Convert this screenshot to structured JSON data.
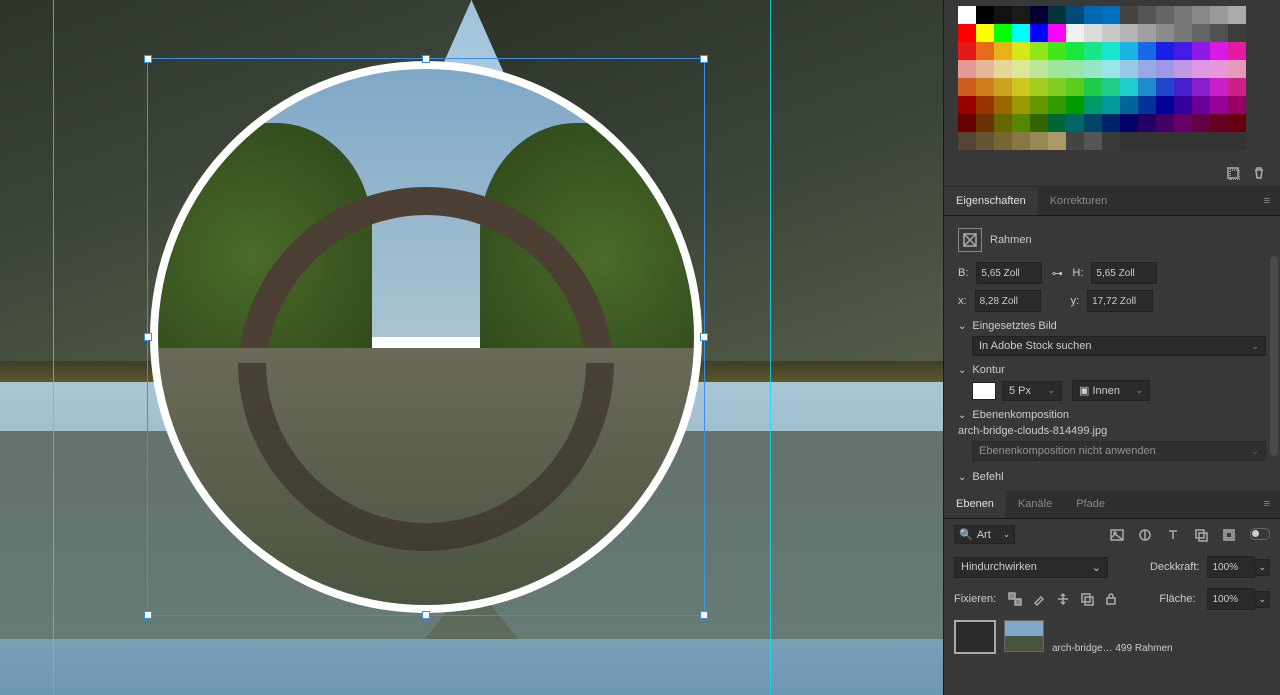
{
  "swatches": [
    [
      "#ffffff",
      "#000000",
      "#111111",
      "#1a1a1a",
      "#000033",
      "#00333a",
      "#004a7a",
      "#0068b0",
      "#006fc0",
      "#444444",
      "#555555",
      "#666666",
      "#777777",
      "#888888",
      "#999999",
      "#aaaaaa"
    ],
    [
      "#ff0000",
      "#ffff00",
      "#00ff00",
      "#00ffff",
      "#0000ff",
      "#ff00ff",
      "#f0f0f0",
      "#dcdcdc",
      "#c8c8c8",
      "#b4b4b4",
      "#a0a0a0",
      "#8c8c8c",
      "#787878",
      "#646464",
      "#505050",
      "#3c3c3c"
    ],
    [
      "#e61919",
      "#e66b19",
      "#e6b319",
      "#d6e619",
      "#8ce619",
      "#42e619",
      "#19e63e",
      "#19e688",
      "#19e6d1",
      "#19b3e6",
      "#1969e6",
      "#191fe6",
      "#4519e6",
      "#8f19e6",
      "#d919e6",
      "#e619a3"
    ],
    [
      "#e69999",
      "#e6b899",
      "#e6d699",
      "#dde699",
      "#bde699",
      "#9ee699",
      "#99e6a8",
      "#99e6c7",
      "#99e6e6",
      "#99c7e6",
      "#99a8e6",
      "#9e99e6",
      "#bd99e6",
      "#dd99e6",
      "#e699d6",
      "#e699b8"
    ],
    [
      "#cc5c1f",
      "#cc801f",
      "#cca31f",
      "#ccc71f",
      "#a3cc1f",
      "#80cc1f",
      "#5ccc1f",
      "#1fcc47",
      "#1fcc8a",
      "#1fcccc",
      "#1f8acc",
      "#1f47cc",
      "#471fcc",
      "#8a1fcc",
      "#cc1fcc",
      "#cc1f8a"
    ],
    [
      "#990000",
      "#993300",
      "#996600",
      "#999900",
      "#669900",
      "#339900",
      "#009900",
      "#009966",
      "#009999",
      "#006699",
      "#003399",
      "#000099",
      "#330099",
      "#660099",
      "#990099",
      "#990066"
    ],
    [
      "#660000",
      "#663300",
      "#666600",
      "#558800",
      "#336600",
      "#006633",
      "#006666",
      "#004466",
      "#002266",
      "#000066",
      "#220066",
      "#440066",
      "#660066",
      "#660044",
      "#660022",
      "#660011"
    ],
    [
      "#554433",
      "#665533",
      "#776633",
      "#887744",
      "#998855",
      "#aa9966",
      "#444444",
      "#555555",
      "#3a3a3a",
      "#333333",
      "#333333",
      "#333333",
      "#333333",
      "#333333",
      "#333333",
      "#333333"
    ]
  ],
  "propertiesPanel": {
    "tabs": {
      "properties": "Eigenschaften",
      "corrections": "Korrekturen"
    },
    "frame": "Rahmen",
    "w_label": "B:",
    "w_value": "5,65 Zoll",
    "h_label": "H:",
    "h_value": "5,65 Zoll",
    "x_label": "x:",
    "x_value": "8,28 Zoll",
    "y_label": "y:",
    "y_value": "17,72 Zoll",
    "linkedImage": "Eingesetztes Bild",
    "searchStock": "In Adobe Stock suchen",
    "stroke": "Kontur",
    "strokeSize": "5 Px",
    "strokeAlign": "Innen",
    "layerComp": "Ebenenkomposition",
    "fileName": "arch-bridge-clouds-814499.jpg",
    "compDropdown": "Ebenenkomposition nicht anwenden",
    "command": "Befehl"
  },
  "layersPanel": {
    "tabs": {
      "layers": "Ebenen",
      "channels": "Kanäle",
      "paths": "Pfade"
    },
    "kind": "Art",
    "blend": "Hindurchwirken",
    "opacityLabel": "Deckkraft:",
    "opacity": "100%",
    "lockLabel": "Fixieren:",
    "fillLabel": "Fläche:",
    "fill": "100%",
    "thumbLabel": "arch-bridge… 499 Rahmen"
  }
}
